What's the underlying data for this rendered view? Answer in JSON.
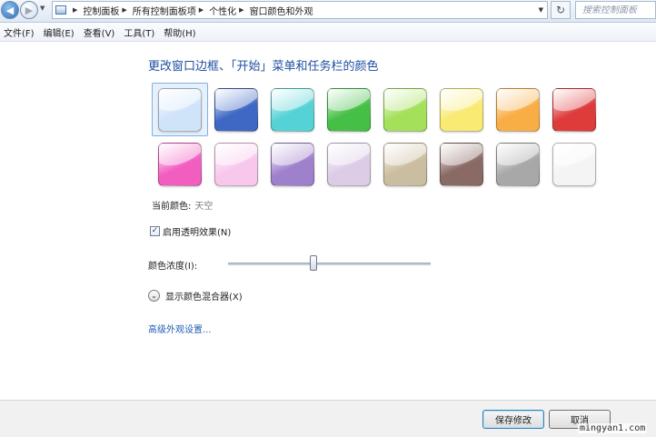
{
  "address_bar": {
    "breadcrumbs": [
      "控制面板",
      "所有控制面板项",
      "个性化",
      "窗口颜色和外观"
    ],
    "search_placeholder": "搜索控制面板",
    "icons": {
      "back": "back-arrow-icon",
      "forward": "forward-arrow-icon",
      "refresh": "refresh-icon",
      "search": "search-icon"
    }
  },
  "menu": [
    "文件(F)",
    "编辑(E)",
    "查看(V)",
    "工具(T)",
    "帮助(H)"
  ],
  "main": {
    "title": "更改窗口边框、「开始」菜单和任务栏的颜色",
    "colors": [
      {
        "color": "#cfe3f9",
        "selected": true
      },
      {
        "color": "#3f68c4"
      },
      {
        "color": "#55d2d6"
      },
      {
        "color": "#46bf46"
      },
      {
        "color": "#a4e05a"
      },
      {
        "color": "#f8ea73"
      },
      {
        "color": "#f9ad45"
      },
      {
        "color": "#de3b3b"
      },
      {
        "color": "#f25ec0"
      },
      {
        "color": "#f8c8ec"
      },
      {
        "color": "#9f80cc"
      },
      {
        "color": "#dccce6"
      },
      {
        "color": "#cbbd9f"
      },
      {
        "color": "#8a6a65"
      },
      {
        "color": "#a8a8a8"
      },
      {
        "color": "#f4f4f4"
      }
    ],
    "current_color_label": "当前颜色:",
    "current_color_value": "天空",
    "transparency": {
      "label": "启用透明效果(N)",
      "checked": true
    },
    "intensity": {
      "label": "颜色浓度(I):",
      "value_fraction": 0.42
    },
    "mixer_label": "显示颜色混合器(X)",
    "advanced_link": "高级外观设置..."
  },
  "footer": {
    "save_label": "保存修改",
    "cancel_label": "取消"
  },
  "watermark": "mingyan1.com"
}
